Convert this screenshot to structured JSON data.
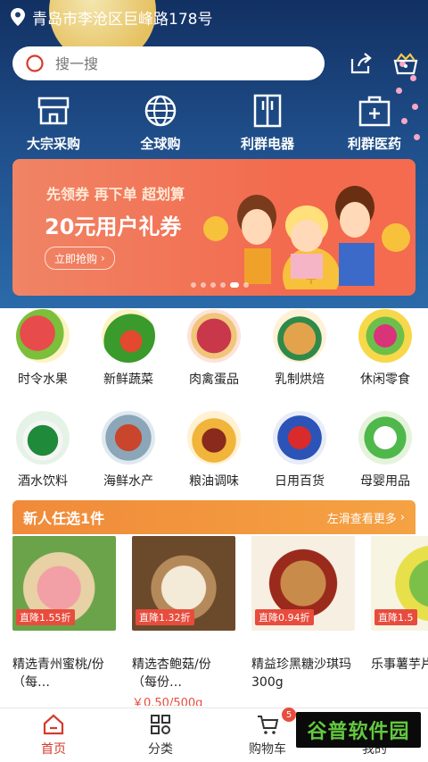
{
  "header": {
    "location": "青岛市李沧区巨峰路178号",
    "search_placeholder": "搜一搜"
  },
  "quick_links": [
    {
      "label": "大宗采购",
      "icon": "store-icon"
    },
    {
      "label": "全球购",
      "icon": "globe-icon"
    },
    {
      "label": "利群电器",
      "icon": "fridge-icon"
    },
    {
      "label": "利群医药",
      "icon": "medkit-icon"
    }
  ],
  "banner": {
    "line1": "先领券 再下单 超划算",
    "line2": "20元用户礼券",
    "button": "立即抢购"
  },
  "categories": [
    {
      "label": "时令水果"
    },
    {
      "label": "新鲜蔬菜"
    },
    {
      "label": "肉禽蛋品"
    },
    {
      "label": "乳制烘焙"
    },
    {
      "label": "休闲零食"
    },
    {
      "label": "酒水饮料"
    },
    {
      "label": "海鲜水产"
    },
    {
      "label": "粮油调味"
    },
    {
      "label": "日用百货"
    },
    {
      "label": "母婴用品"
    }
  ],
  "promo": {
    "title": "新人任选1件",
    "more": "左滑查看更多"
  },
  "products": [
    {
      "badge": "直降1.55折",
      "name": "精选青州蜜桃/份（每…",
      "price": ""
    },
    {
      "badge": "直降1.32折",
      "name": "精选杏鲍菇/份（每份…",
      "price": "￥0.50/500g"
    },
    {
      "badge": "直降0.94折",
      "name": "精益珍黑糖沙琪玛300g",
      "price": ""
    },
    {
      "badge": "直降1.5",
      "name": "乐事薯芋片沁",
      "price": ""
    }
  ],
  "tabbar": {
    "home": "首页",
    "category": "分类",
    "cart": "购物车",
    "cart_count": "5",
    "mine": "我的"
  },
  "watermark": "谷普软件园"
}
